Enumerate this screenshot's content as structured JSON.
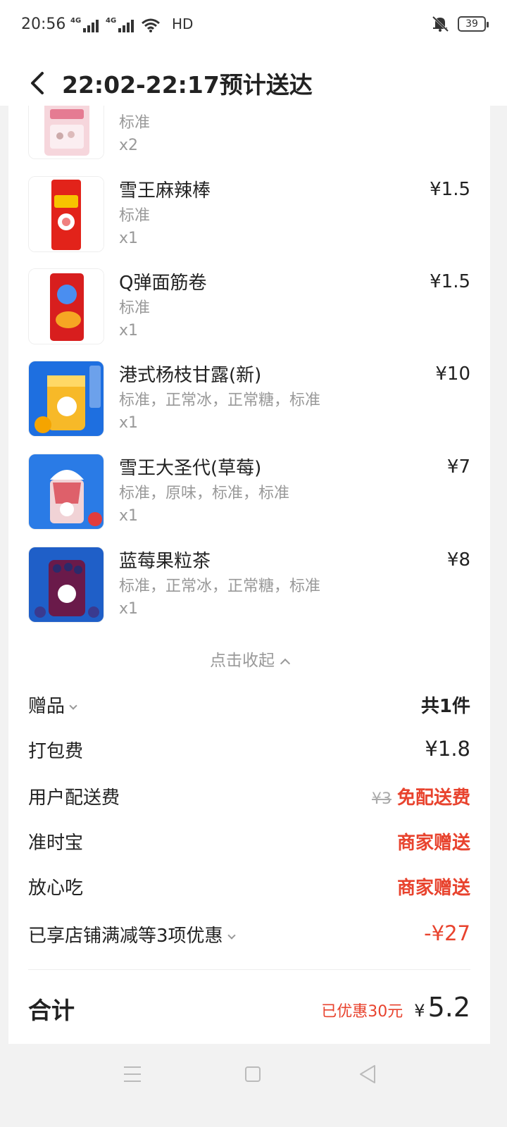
{
  "status_bar": {
    "time": "20:56",
    "network1": "4G",
    "network2": "4G",
    "hd": "HD",
    "battery": "39"
  },
  "header": {
    "title": "22:02-22:17预计送达"
  },
  "items": [
    {
      "name": "",
      "spec": "标准",
      "qty": "x2",
      "price": "",
      "icon": "snack-bag-pink"
    },
    {
      "name": "雪王麻辣棒",
      "spec": "标准",
      "qty": "x1",
      "price": "¥1.5",
      "icon": "snack-bag-red"
    },
    {
      "name": "Q弹面筋卷",
      "spec": "标准",
      "qty": "x1",
      "price": "¥1.5",
      "icon": "snack-bag-red-blue"
    },
    {
      "name": "港式杨枝甘露(新)",
      "spec": "标准，正常冰，正常糖，标准",
      "qty": "x1",
      "price": "¥10",
      "icon": "mango-drink"
    },
    {
      "name": "雪王大圣代(草莓)",
      "spec": "标准，原味，标准，标准",
      "qty": "x1",
      "price": "¥7",
      "icon": "strawberry-sundae"
    },
    {
      "name": "蓝莓果粒茶",
      "spec": "标准，正常冰，正常糖，标准",
      "qty": "x1",
      "price": "¥8",
      "icon": "blueberry-tea"
    }
  ],
  "collapse_label": "点击收起",
  "fees": {
    "gift_label": "赠品",
    "gift_value": "共1件",
    "packing_label": "打包费",
    "packing_value": "¥1.8",
    "delivery_label": "用户配送费",
    "delivery_original": "¥3",
    "delivery_value": "免配送费",
    "ontime_label": "准时宝",
    "ontime_value": "商家赠送",
    "safe_label": "放心吃",
    "safe_value": "商家赠送",
    "discount_label": "已享店铺满减等3项优惠",
    "discount_value": "-¥27"
  },
  "total": {
    "label": "合计",
    "saved": "已优惠30元",
    "currency": "¥",
    "value": "5.2"
  },
  "colors": {
    "accent_red": "#e8432e"
  }
}
